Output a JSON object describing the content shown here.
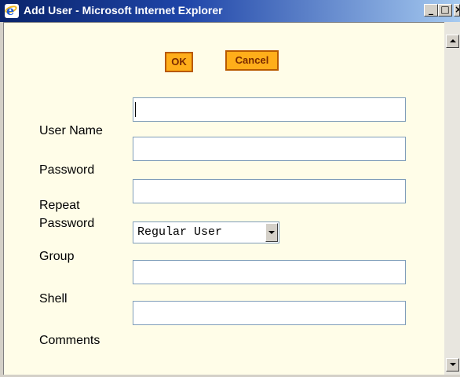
{
  "window": {
    "title": "Add User - Microsoft Internet Explorer",
    "controls": {
      "minimize": "_",
      "maximize": "□",
      "close": "×"
    }
  },
  "buttons": {
    "ok": "OK",
    "cancel": "Cancel"
  },
  "form": {
    "username_label": "User Name",
    "username_value": "",
    "password_label": "Password",
    "password_value": "",
    "repeat_password_label_line1": "Repeat",
    "repeat_password_label_line2": "Password",
    "repeat_password_value": "",
    "group_label": "Group",
    "group_selected": "Regular User",
    "shell_label": "Shell",
    "shell_value": "",
    "comments_label": "Comments",
    "comments_value": ""
  },
  "colors": {
    "content_background": "#fffde8",
    "button_background": "#ffae1a",
    "button_border": "#b85a00",
    "button_text": "#7a2a00",
    "titlebar_start": "#0a246a",
    "titlebar_end": "#a6caf0"
  },
  "icons": {
    "window_icon": "internet-explorer-icon",
    "scroll_up": "scroll-up-arrow",
    "scroll_down": "scroll-down-arrow",
    "dropdown": "chevron-down-icon"
  }
}
